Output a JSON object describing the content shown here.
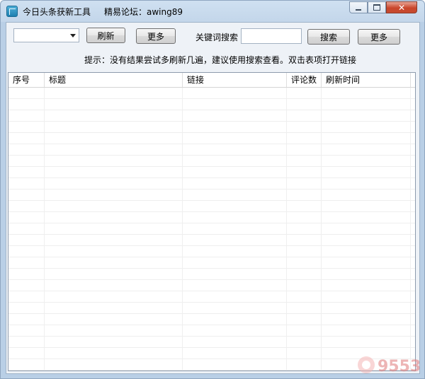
{
  "window": {
    "title": "今日头条获新工具",
    "forum": "精易论坛：awing89",
    "controls": {
      "minimize": "minimize",
      "maximize": "maximize",
      "close": "✕"
    }
  },
  "toolbar": {
    "combo_value": "",
    "refresh_label": "刷新",
    "more_label_1": "更多",
    "keyword_label": "关键词搜索",
    "search_value": "",
    "search_label": "搜索",
    "more_label_2": "更多"
  },
  "hint": "提示：没有结果尝试多刷新几遍，建议使用搜索查看。双击表项打开链接",
  "table": {
    "columns": [
      "序号",
      "标题",
      "链接",
      "评论数",
      "刷新时间"
    ],
    "rows": []
  },
  "watermark": {
    "text": "9553"
  }
}
